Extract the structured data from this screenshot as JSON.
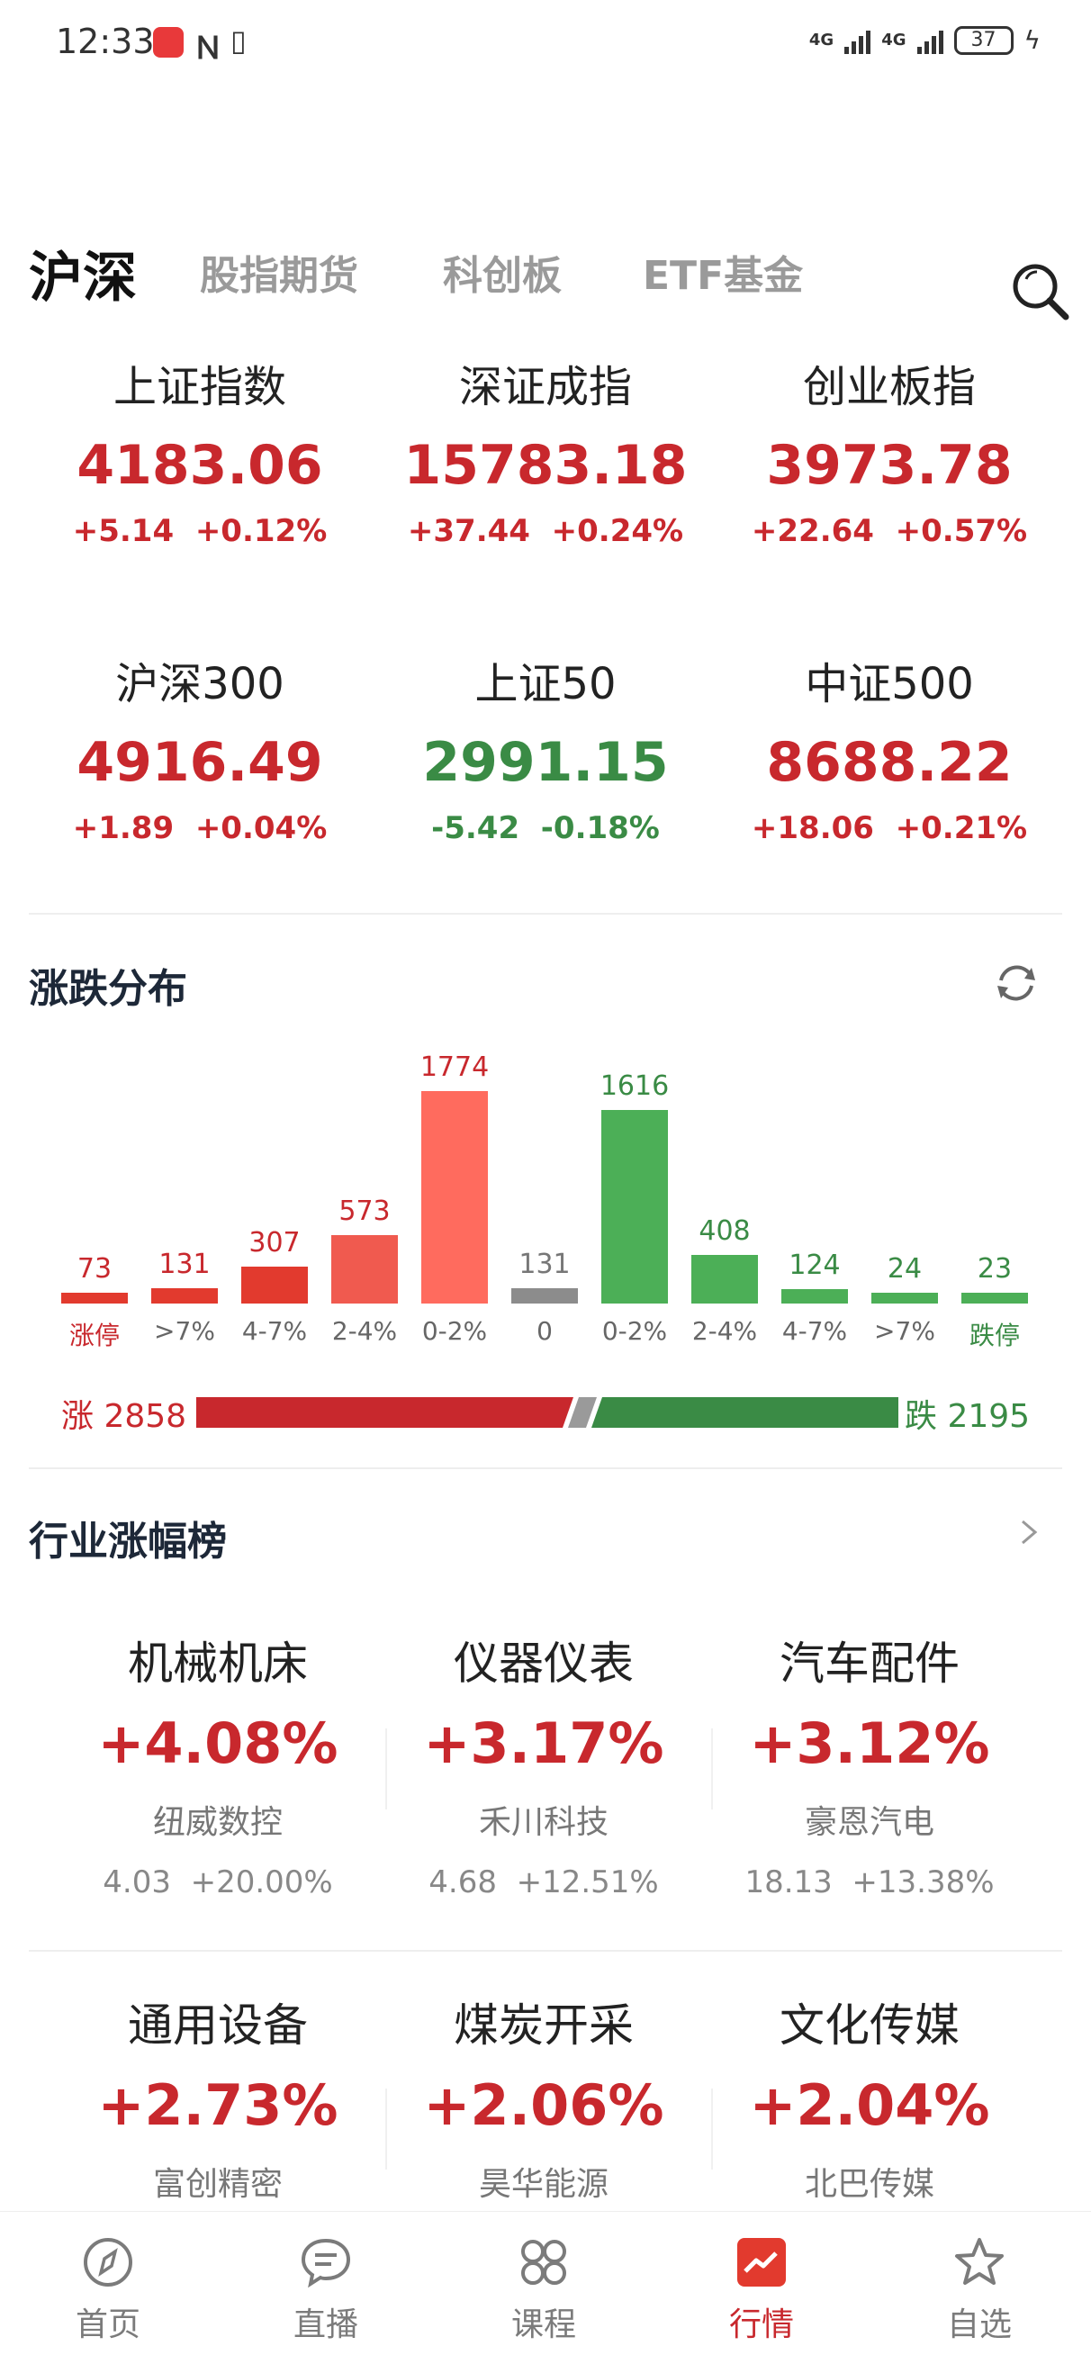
{
  "status": {
    "time": "12:33",
    "network": "4G",
    "battery": "37"
  },
  "tabs": [
    {
      "label": "沪深",
      "active": true
    },
    {
      "label": "股指期货",
      "active": false
    },
    {
      "label": "科创板",
      "active": false
    },
    {
      "label": "ETF基金",
      "active": false
    }
  ],
  "indices": [
    {
      "name": "上证指数",
      "price": "4183.06",
      "change": "+5.14",
      "pct": "+0.12%",
      "trend": "up"
    },
    {
      "name": "深证成指",
      "price": "15783.18",
      "change": "+37.44",
      "pct": "+0.24%",
      "trend": "up"
    },
    {
      "name": "创业板指",
      "price": "3973.78",
      "change": "+22.64",
      "pct": "+0.57%",
      "trend": "up"
    },
    {
      "name": "沪深300",
      "price": "4916.49",
      "change": "+1.89",
      "pct": "+0.04%",
      "trend": "up"
    },
    {
      "name": "上证50",
      "price": "2991.15",
      "change": "-5.42",
      "pct": "-0.18%",
      "trend": "down"
    },
    {
      "name": "中证500",
      "price": "8688.22",
      "change": "+18.06",
      "pct": "+0.21%",
      "trend": "up"
    }
  ],
  "distribution": {
    "title": "涨跌分布",
    "up_label": "涨",
    "down_label": "跌",
    "up_total": "2858",
    "down_total": "2195",
    "colors": {
      "up_strong": "#e23a2e",
      "up_mid": "#f05a4f",
      "up_light": "#ff6b5e",
      "flat": "#8c8c8c",
      "down": "#4caf57",
      "text_up": "#c8282d",
      "text_down": "#3a8b45"
    }
  },
  "chart_data": {
    "type": "bar",
    "title": "涨跌分布",
    "categories": [
      "涨停",
      ">7%",
      "4-7%",
      "2-4%",
      "0-2%",
      "0",
      "0-2%",
      "2-4%",
      "4-7%",
      ">7%",
      "跌停"
    ],
    "values": [
      73,
      131,
      307,
      573,
      1774,
      131,
      1616,
      408,
      124,
      24,
      23
    ],
    "groups": [
      "up",
      "up",
      "up",
      "up",
      "up",
      "flat",
      "down",
      "down",
      "down",
      "down",
      "down"
    ]
  },
  "industry": {
    "title": "行业涨幅榜",
    "items": [
      {
        "name": "机械机床",
        "pct": "+4.08%",
        "stock": "纽威数控",
        "price": "4.03",
        "stock_pct": "+20.00%"
      },
      {
        "name": "仪器仪表",
        "pct": "+3.17%",
        "stock": "禾川科技",
        "price": "4.68",
        "stock_pct": "+12.51%"
      },
      {
        "name": "汽车配件",
        "pct": "+3.12%",
        "stock": "豪恩汽电",
        "price": "18.13",
        "stock_pct": "+13.38%"
      },
      {
        "name": "通用设备",
        "pct": "+2.73%",
        "stock": "富创精密",
        "price": "",
        "stock_pct": ""
      },
      {
        "name": "煤炭开采",
        "pct": "+2.06%",
        "stock": "昊华能源",
        "price": "",
        "stock_pct": ""
      },
      {
        "name": "文化传媒",
        "pct": "+2.04%",
        "stock": "北巴传媒",
        "price": "",
        "stock_pct": ""
      }
    ]
  },
  "nav": [
    {
      "label": "首页",
      "icon": "compass-icon",
      "active": false
    },
    {
      "label": "直播",
      "icon": "chat-bubble-icon",
      "active": false
    },
    {
      "label": "课程",
      "icon": "grid-clover-icon",
      "active": false
    },
    {
      "label": "行情",
      "icon": "chart-line-icon",
      "active": true
    },
    {
      "label": "自选",
      "icon": "star-icon",
      "active": false
    }
  ]
}
